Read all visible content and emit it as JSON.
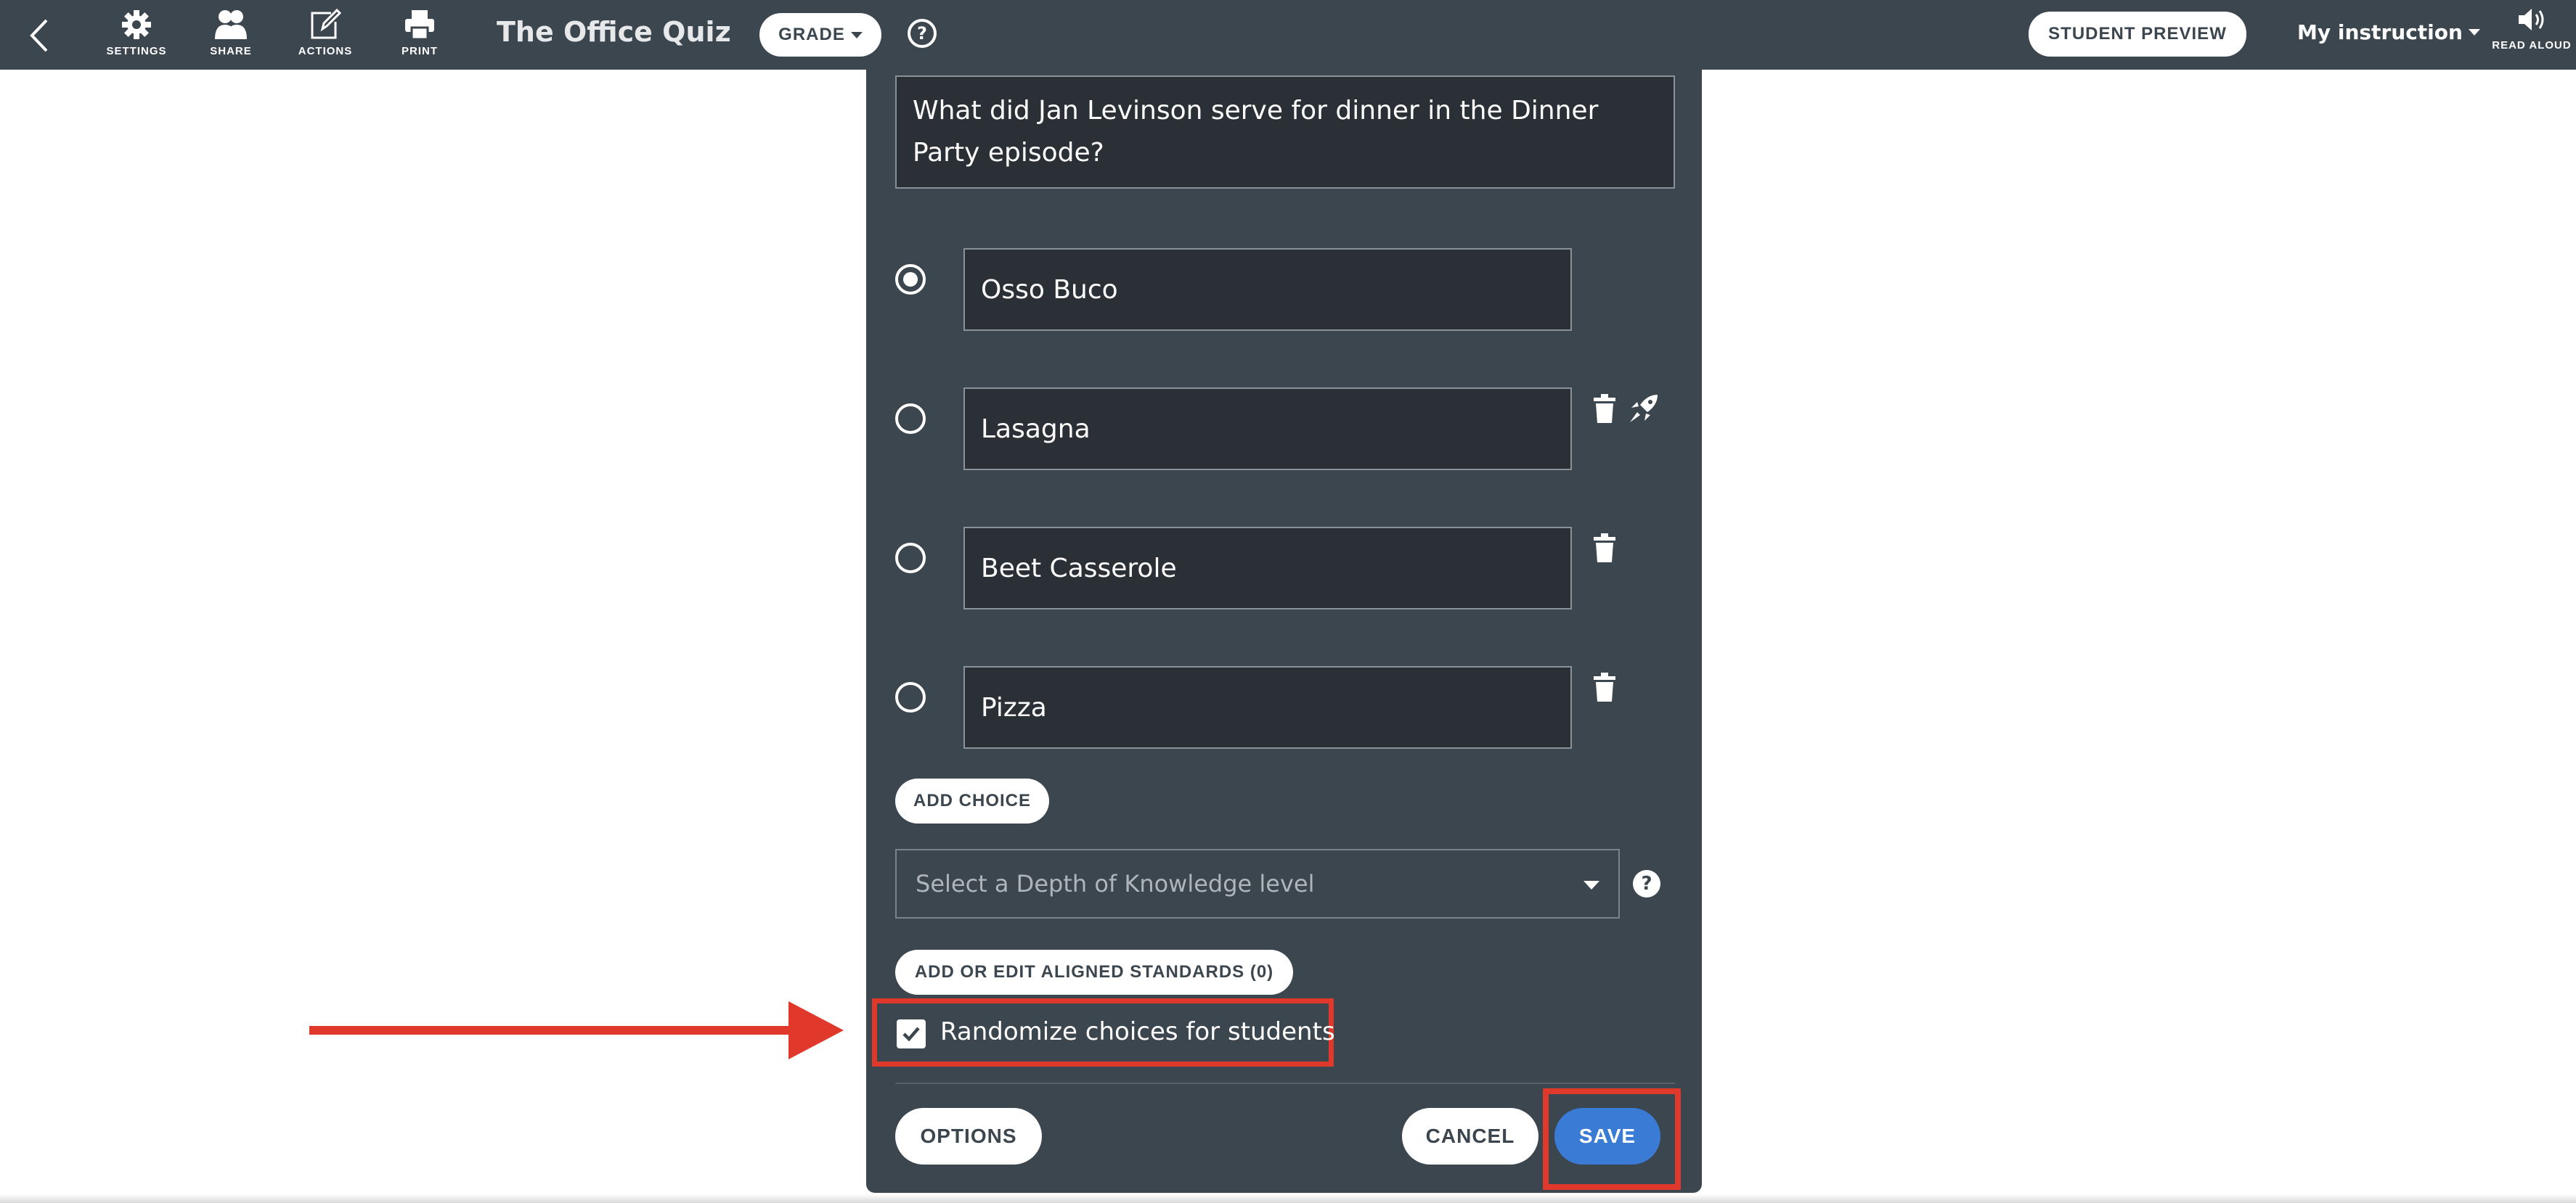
{
  "topbar": {
    "tools": [
      {
        "label": "SETTINGS",
        "icon": "gear-icon"
      },
      {
        "label": "SHARE",
        "icon": "people-icon"
      },
      {
        "label": "ACTIONS",
        "icon": "edit-icon"
      },
      {
        "label": "PRINT",
        "icon": "printer-icon"
      }
    ],
    "title": "The Office Quiz",
    "grade_label": "GRADE",
    "help_glyph": "?",
    "student_preview_label": "STUDENT PREVIEW",
    "instruction_label": "My instruction",
    "read_aloud_label": "READ ALOUD"
  },
  "editor": {
    "question": "What did Jan Levinson serve for dinner in the Dinner Party episode?",
    "choices": [
      {
        "text": "Osso Buco",
        "selected": true
      },
      {
        "text": "Lasagna",
        "selected": false
      },
      {
        "text": "Beet Casserole",
        "selected": false
      },
      {
        "text": "Pizza",
        "selected": false
      }
    ],
    "add_choice_label": "ADD CHOICE",
    "dok_placeholder": "Select a Depth of Knowledge level",
    "dok_help_glyph": "?",
    "standards_label": "ADD OR EDIT ALIGNED STANDARDS (0)",
    "randomize_label": "Randomize choices for students",
    "randomize_checked": true,
    "options_label": "OPTIONS",
    "cancel_label": "CANCEL",
    "save_label": "SAVE"
  },
  "colors": {
    "panel": "#3c464f",
    "input_bg": "#2a3036",
    "accent": "#3a7bd5",
    "annotation": "#e0382a"
  }
}
